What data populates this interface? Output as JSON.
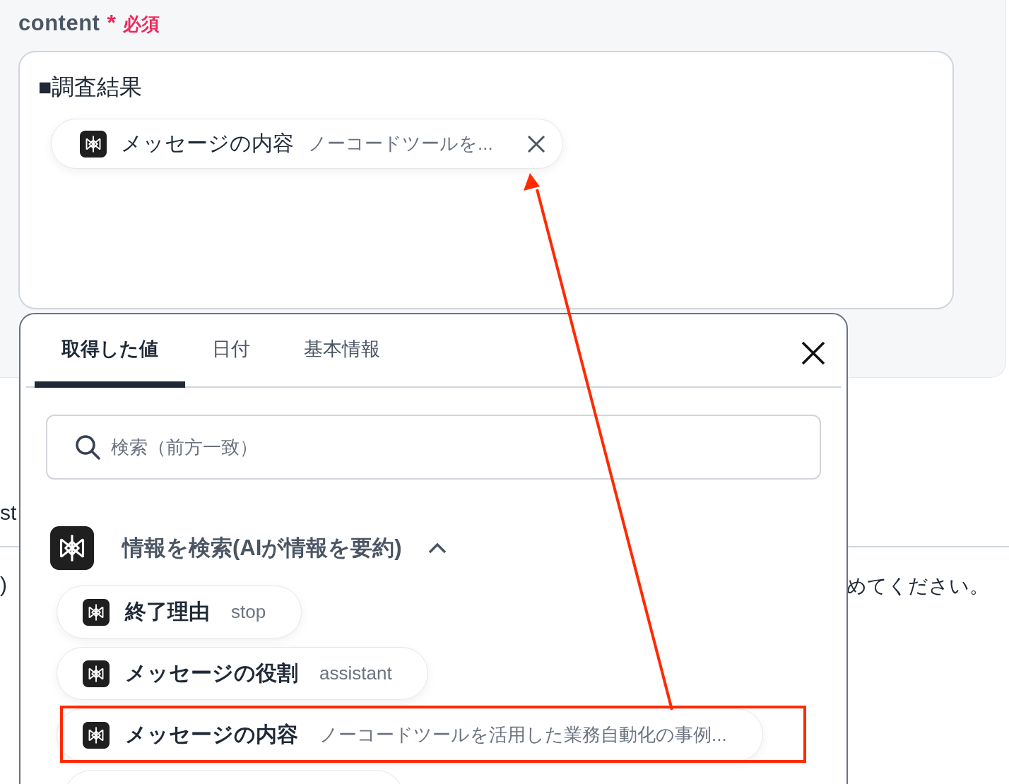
{
  "field": {
    "label": "content",
    "required_mark": "*",
    "required_text": "必須"
  },
  "editor": {
    "heading": "■調査結果",
    "chip": {
      "name": "メッセージの内容",
      "value": "ノーコードツールを..."
    }
  },
  "background_texts": {
    "left_top": "st",
    "left_bottom": ")",
    "right_bottom": "めてください。"
  },
  "popup": {
    "tabs": [
      {
        "label": "取得した値",
        "selected": true
      },
      {
        "label": "日付",
        "selected": false
      },
      {
        "label": "基本情報",
        "selected": false
      }
    ],
    "search": {
      "placeholder": "検索（前方一致）"
    },
    "group": {
      "title": "情報を検索(AIが情報を要約)",
      "expanded": true
    },
    "items": [
      {
        "name": "終了理由",
        "value": "stop",
        "highlighted": false
      },
      {
        "name": "メッセージの役割",
        "value": "assistant",
        "highlighted": false
      },
      {
        "name": "メッセージの内容",
        "value": "ノーコードツールを活用した業務自動化の事例...",
        "highlighted": true
      }
    ]
  }
}
